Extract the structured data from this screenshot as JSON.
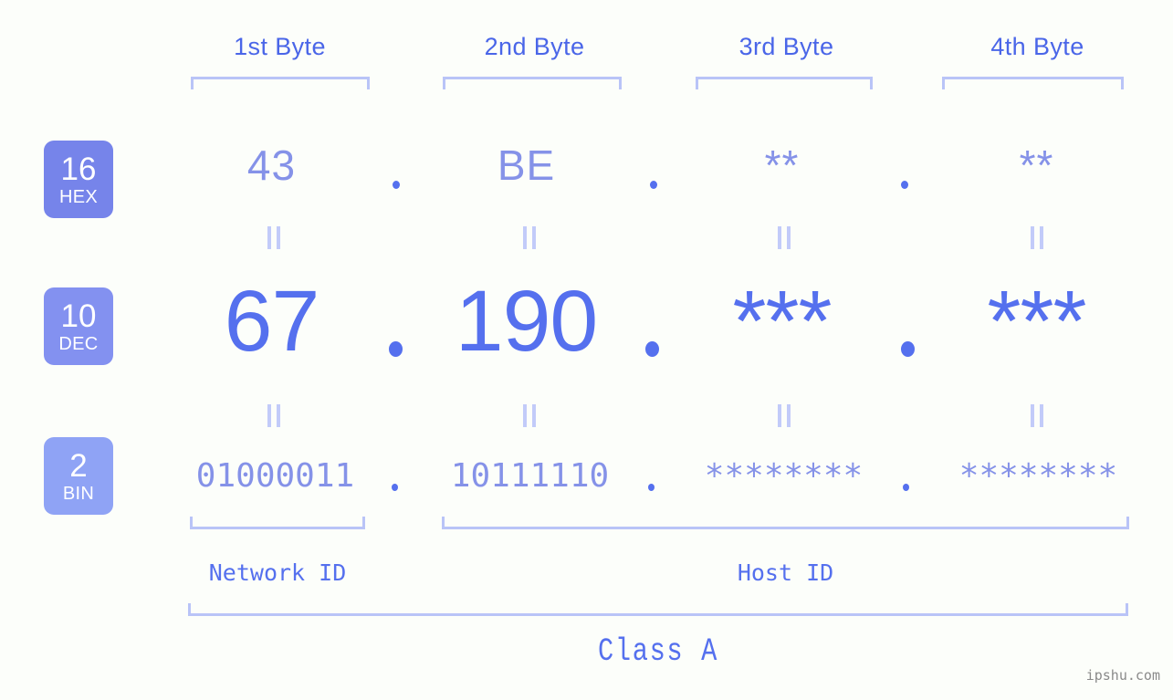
{
  "page": {
    "background_color": "#fcfefa",
    "watermark": "ipshu.com"
  },
  "colors": {
    "header_text": "#4a66e8",
    "bracket": "#b9c4f7",
    "badge_hex": "#7684ea",
    "badge_dec": "#8391f0",
    "badge_bin": "#8fa3f5",
    "value_strong": "#5570ee",
    "value_light": "#8592e8",
    "equals_mark": "#c2cbf9",
    "watermark": "#8a8a8a"
  },
  "byte_headers": [
    {
      "label": "1st Byte"
    },
    {
      "label": "2nd Byte"
    },
    {
      "label": "3rd Byte"
    },
    {
      "label": "4th Byte"
    }
  ],
  "rows": [
    {
      "key": "hex",
      "badge_number": "16",
      "badge_label": "HEX",
      "values": [
        "43",
        "BE",
        "**",
        "**"
      ],
      "separator": "."
    },
    {
      "key": "dec",
      "badge_number": "10",
      "badge_label": "DEC",
      "values": [
        "67",
        "190",
        "***",
        "***"
      ],
      "separator": "."
    },
    {
      "key": "bin",
      "badge_number": "2",
      "badge_label": "BIN",
      "values": [
        "01000011",
        "10111110",
        "********",
        "********"
      ],
      "separator": "."
    }
  ],
  "equals_marks": {
    "symbol": "||",
    "count_per_gap": 4
  },
  "id_sections": [
    {
      "label": "Network ID",
      "span": "1st byte"
    },
    {
      "label": "Host ID",
      "span": "2nd to 4th bytes"
    }
  ],
  "class_section": {
    "label": "Class A"
  }
}
